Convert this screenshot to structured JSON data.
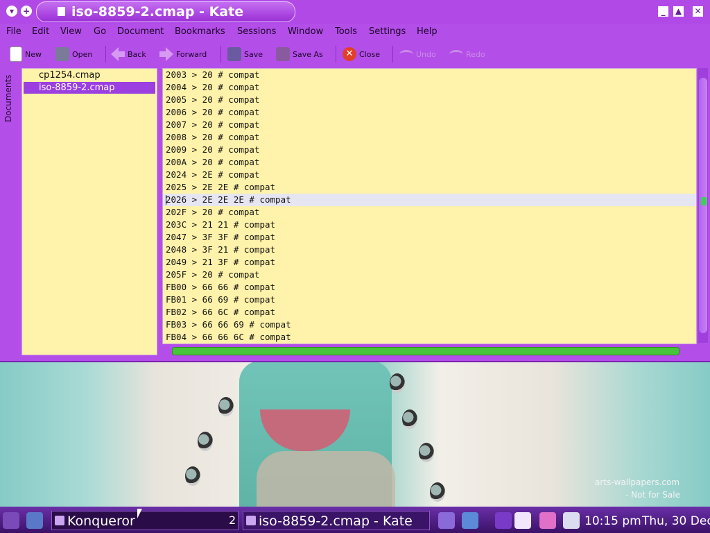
{
  "window": {
    "title": "iso-8859-2.cmap - Kate",
    "accent": "#b44ee8"
  },
  "menubar": {
    "items": [
      "File",
      "Edit",
      "View",
      "Go",
      "Document",
      "Bookmarks",
      "Sessions",
      "Window",
      "Tools",
      "Settings",
      "Help"
    ]
  },
  "toolbar": {
    "new": "New",
    "open": "Open",
    "back": "Back",
    "forward": "Forward",
    "save": "Save",
    "save_as": "Save As",
    "close": "Close",
    "undo": "Undo",
    "redo": "Redo"
  },
  "sidebar": {
    "tab_label": "Documents",
    "documents": [
      {
        "name": "cp1254.cmap",
        "selected": false
      },
      {
        "name": "iso-8859-2.cmap",
        "selected": true
      }
    ]
  },
  "editor": {
    "current_line_index": 10,
    "lines": [
      "2003 > 20 # compat",
      "2004 > 20 # compat",
      "2005 > 20 # compat",
      "2006 > 20 # compat",
      "2007 > 20 # compat",
      "2008 > 20 # compat",
      "2009 > 20 # compat",
      "200A > 20 # compat",
      "2024 > 2E # compat",
      "2025 > 2E 2E # compat",
      "2026 > 2E 2E 2E # compat",
      "202F > 20 # compat",
      "203C > 21 21 # compat",
      "2047 > 3F 3F # compat",
      "2048 > 3F 21 # compat",
      "2049 > 21 3F # compat",
      "205F > 20 # compat",
      "FB00 > 66 66 # compat",
      "FB01 > 66 69 # compat",
      "FB02 > 66 6C # compat",
      "FB03 > 66 66 69 # compat",
      "FB04 > 66 66 6C # compat"
    ]
  },
  "wallpaper": {
    "watermark_site": "arts-wallpapers.com",
    "watermark_note": "- Not for Sale"
  },
  "taskbar": {
    "tasks": [
      {
        "label": "Konqueror",
        "count": "2"
      },
      {
        "label": "iso-8859-2.cmap - Kate"
      }
    ],
    "clock": "10:15 pm",
    "date": "Thu, 30 Dec"
  }
}
